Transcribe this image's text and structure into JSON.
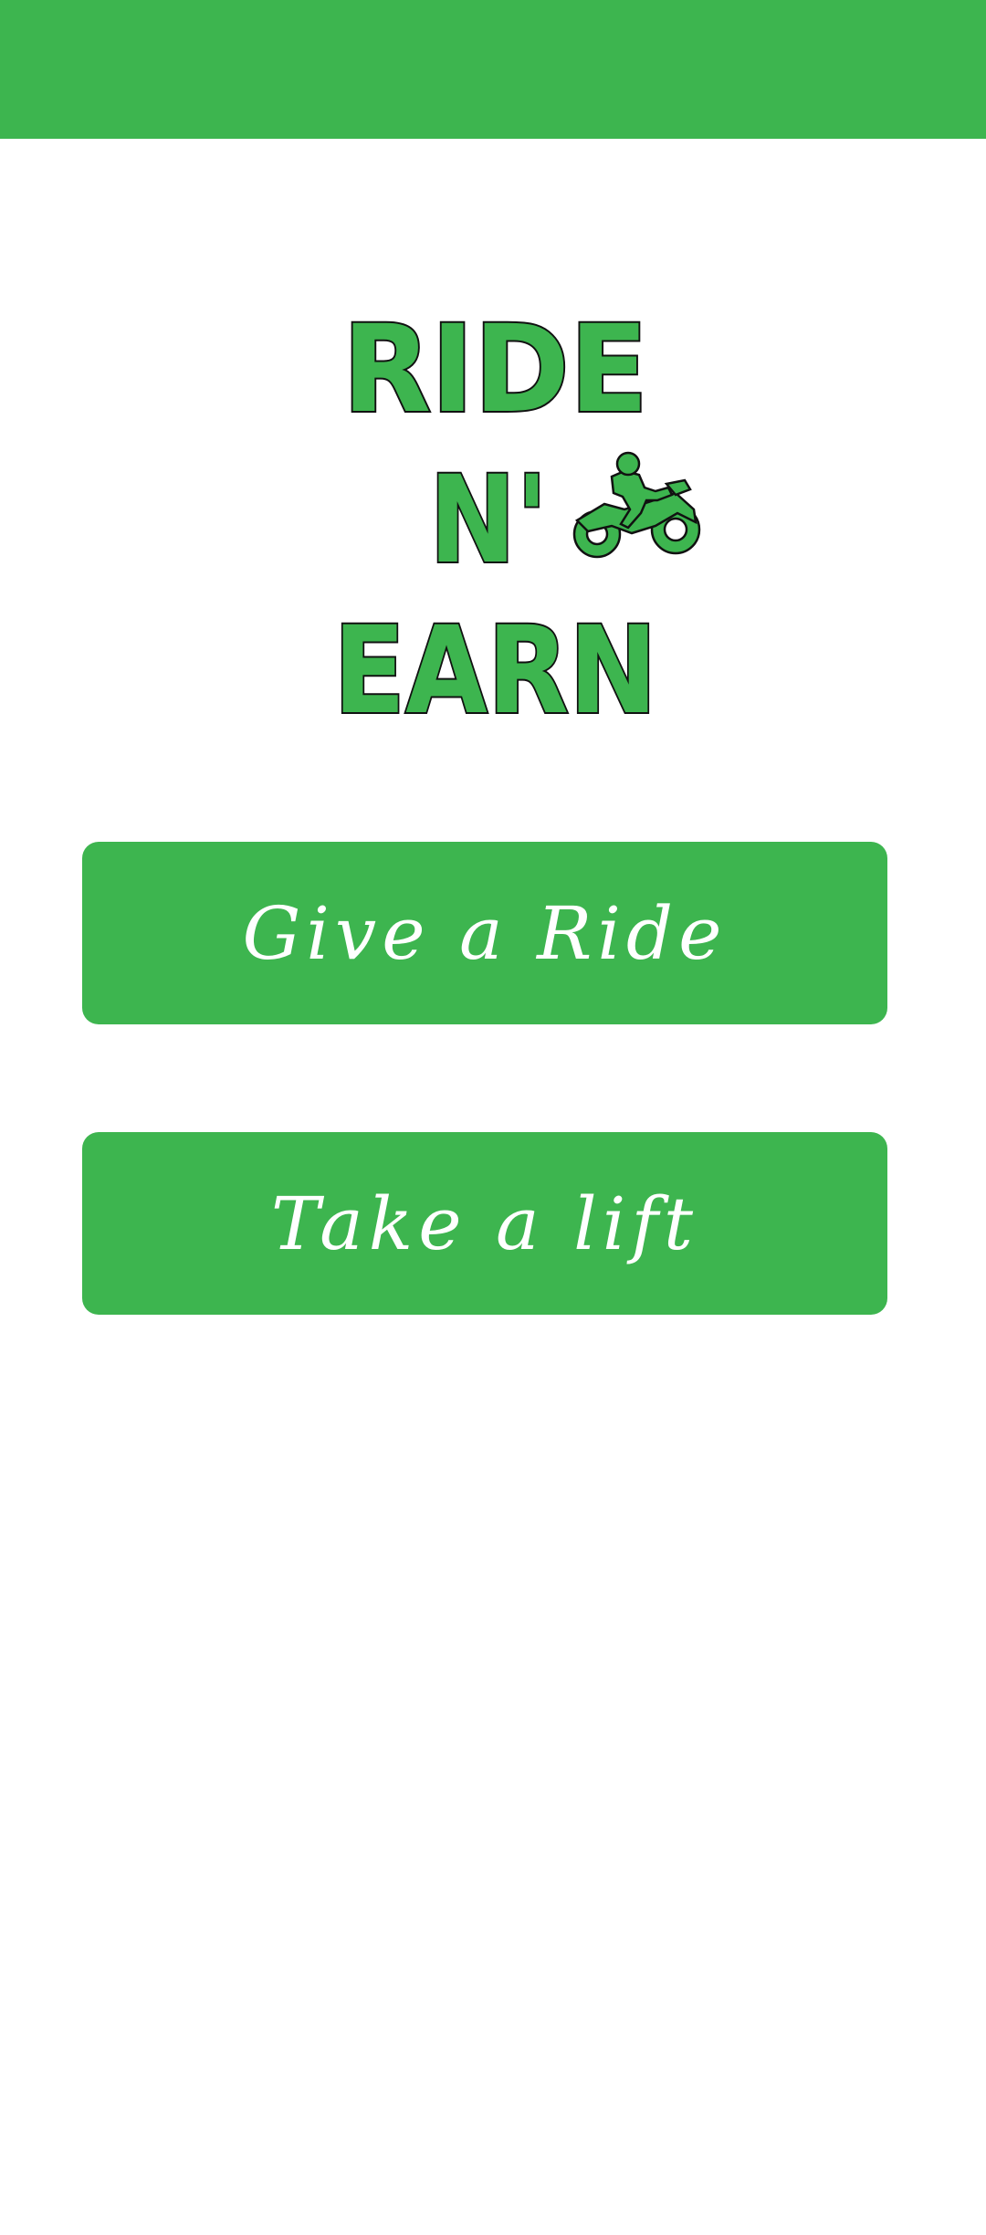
{
  "theme": {
    "accent": "#3db54f",
    "outline": "#111111",
    "background": "#ffffff"
  },
  "logo": {
    "line1": "RIDE",
    "line2": "N'",
    "line3": "EARN",
    "icon": "motorcycle-rider-icon"
  },
  "buttons": {
    "give_ride": "Give a Ride",
    "take_lift": "Take a lift"
  }
}
